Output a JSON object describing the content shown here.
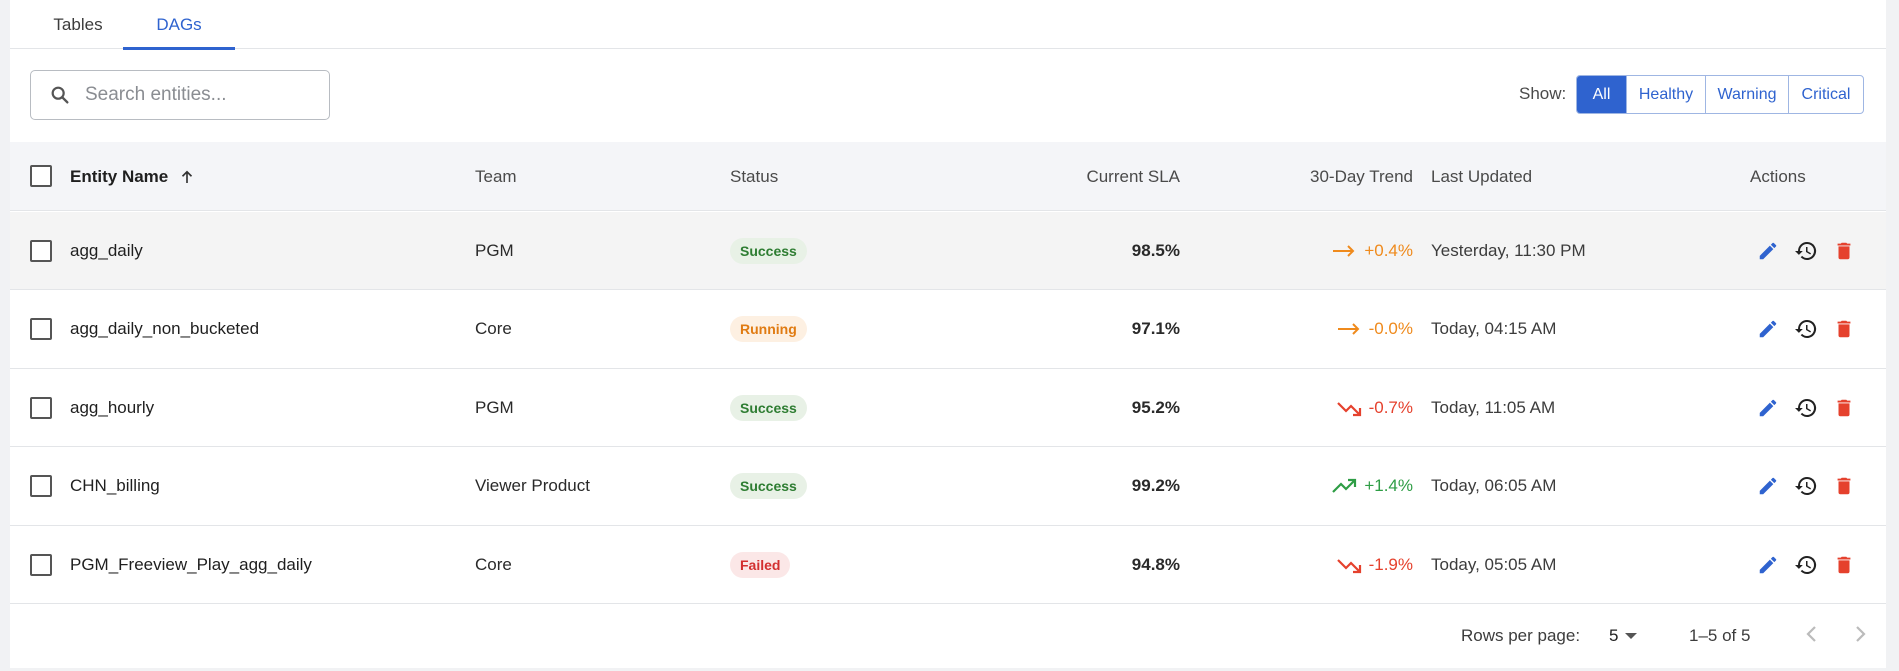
{
  "tabs": [
    {
      "label": "Tables",
      "active": false
    },
    {
      "label": "DAGs",
      "active": true
    }
  ],
  "search": {
    "placeholder": "Search entities...",
    "value": ""
  },
  "filter": {
    "label": "Show:",
    "options": [
      "All",
      "Healthy",
      "Warning",
      "Critical"
    ],
    "selected": "All"
  },
  "table": {
    "columns": {
      "name": "Entity Name",
      "team": "Team",
      "status": "Status",
      "sla": "Current SLA",
      "trend": "30-Day Trend",
      "updated": "Last Updated",
      "actions": "Actions"
    },
    "sort": {
      "column": "Entity Name",
      "direction": "ascending"
    },
    "rows": [
      {
        "name": "agg_daily",
        "team": "PGM",
        "status": "Success",
        "sla": "98.5%",
        "trend": "+0.4%",
        "trend_icon": "trending-flat-icon",
        "updated": "Yesterday, 11:30 PM"
      },
      {
        "name": "agg_daily_non_bucketed",
        "team": "Core",
        "status": "Running",
        "sla": "97.1%",
        "trend": "-0.0%",
        "trend_icon": "trending-flat-icon",
        "updated": "Today, 04:15 AM"
      },
      {
        "name": "agg_hourly",
        "team": "PGM",
        "status": "Success",
        "sla": "95.2%",
        "trend": "-0.7%",
        "trend_icon": "trending-down-icon",
        "updated": "Today, 11:05 AM"
      },
      {
        "name": "CHN_billing",
        "team": "Viewer Product",
        "status": "Success",
        "sla": "99.2%",
        "trend": "+1.4%",
        "trend_icon": "trending-up-icon",
        "updated": "Today, 06:05 AM"
      },
      {
        "name": "PGM_Freeview_Play_agg_daily",
        "team": "Core",
        "status": "Failed",
        "sla": "94.8%",
        "trend": "-1.9%",
        "trend_icon": "trending-down-icon",
        "updated": "Today, 05:05 AM"
      }
    ],
    "row_actions": [
      "edit-icon",
      "history-icon",
      "delete-icon"
    ]
  },
  "pagination": {
    "rows_per_page_label": "Rows per page:",
    "rows_per_page": "5",
    "range": "1–5 of 5"
  },
  "colors": {
    "accent": "#2f63cf",
    "success_text": "#2e7d32",
    "success_bg": "#e8f1e6",
    "running_text": "#e07b12",
    "running_bg": "#fdf0e2",
    "failed_text": "#d32f2f",
    "failed_bg": "#fbe7e7",
    "trend_flat": "#ef8a1c",
    "trend_down": "#e5412d",
    "trend_up": "#2e9d45",
    "delete": "#e5412d"
  }
}
